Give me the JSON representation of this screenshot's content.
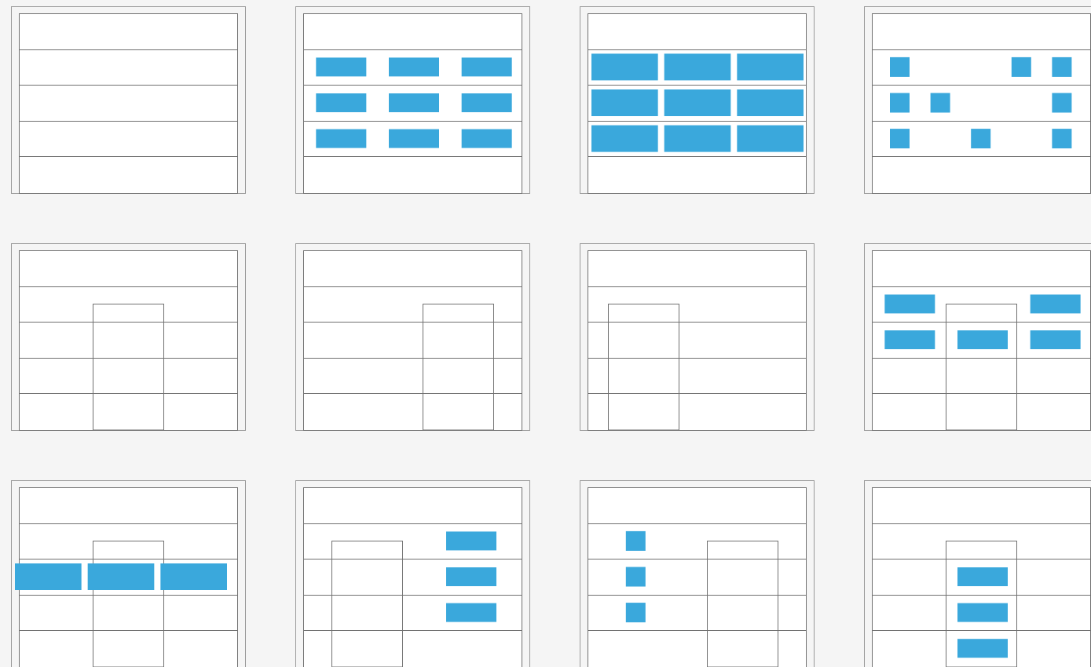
{
  "colors": {
    "background": "#f5f5f5",
    "frame_stroke": "#999999",
    "line_stroke": "#707070",
    "panel_fill": "#ffffff",
    "highlight": "#3aa8dc"
  },
  "diagrams": [
    {
      "id": "plain",
      "window": null,
      "blocks": []
    },
    {
      "id": "grid-padded",
      "window": null,
      "blocks": [
        {
          "row": 1,
          "col": 0,
          "size": "pad"
        },
        {
          "row": 1,
          "col": 1,
          "size": "pad"
        },
        {
          "row": 1,
          "col": 2,
          "size": "pad"
        },
        {
          "row": 2,
          "col": 0,
          "size": "pad"
        },
        {
          "row": 2,
          "col": 1,
          "size": "pad"
        },
        {
          "row": 2,
          "col": 2,
          "size": "pad"
        },
        {
          "row": 3,
          "col": 0,
          "size": "pad"
        },
        {
          "row": 3,
          "col": 1,
          "size": "pad"
        },
        {
          "row": 3,
          "col": 2,
          "size": "pad"
        }
      ]
    },
    {
      "id": "grid-full",
      "window": null,
      "blocks": [
        {
          "row": 1,
          "col": 0,
          "size": "full"
        },
        {
          "row": 1,
          "col": 1,
          "size": "full"
        },
        {
          "row": 1,
          "col": 2,
          "size": "full"
        },
        {
          "row": 2,
          "col": 0,
          "size": "full"
        },
        {
          "row": 2,
          "col": 1,
          "size": "full"
        },
        {
          "row": 2,
          "col": 2,
          "size": "full"
        },
        {
          "row": 3,
          "col": 0,
          "size": "full"
        },
        {
          "row": 3,
          "col": 1,
          "size": "full"
        },
        {
          "row": 3,
          "col": 2,
          "size": "full"
        }
      ]
    },
    {
      "id": "scattered-squares",
      "window": null,
      "blocks": [
        {
          "row": 1,
          "slot": 0,
          "size": "square"
        },
        {
          "row": 1,
          "slot": 6,
          "size": "square"
        },
        {
          "row": 1,
          "slot": 8,
          "size": "square"
        },
        {
          "row": 2,
          "slot": 0,
          "size": "square"
        },
        {
          "row": 2,
          "slot": 2,
          "size": "square"
        },
        {
          "row": 2,
          "slot": 8,
          "size": "square"
        },
        {
          "row": 3,
          "slot": 0,
          "size": "square"
        },
        {
          "row": 3,
          "slot": 4,
          "size": "square"
        },
        {
          "row": 3,
          "slot": 8,
          "size": "square"
        }
      ]
    },
    {
      "id": "window-center",
      "window": "center",
      "blocks": []
    },
    {
      "id": "window-right",
      "window": "right",
      "blocks": []
    },
    {
      "id": "window-left",
      "window": "left",
      "blocks": []
    },
    {
      "id": "window-center-with-blocks",
      "window": "center",
      "blocks": [
        {
          "row": 1,
          "col": 0,
          "size": "pad"
        },
        {
          "row": 1,
          "col": 2,
          "size": "pad"
        },
        {
          "row": 2,
          "col": 0,
          "size": "pad"
        },
        {
          "row": 2,
          "col": 1,
          "size": "pad"
        },
        {
          "row": 2,
          "col": 2,
          "size": "pad"
        }
      ]
    },
    {
      "id": "window-center-band",
      "window": "center",
      "blocks": [
        {
          "row": 2,
          "col": 0,
          "size": "band"
        },
        {
          "row": 2,
          "col": 1,
          "size": "band"
        },
        {
          "row": 2,
          "col": 2,
          "size": "band"
        }
      ]
    },
    {
      "id": "window-left-blocks-right",
      "window": "left2",
      "blocks": [
        {
          "row": 1,
          "col": 2,
          "size": "pad-right"
        },
        {
          "row": 2,
          "col": 2,
          "size": "pad-right"
        },
        {
          "row": 3,
          "col": 2,
          "size": "pad-right"
        }
      ]
    },
    {
      "id": "window-right-squares-left",
      "window": "right2",
      "blocks": [
        {
          "row": 1,
          "slot": 1,
          "size": "square"
        },
        {
          "row": 2,
          "slot": 1,
          "size": "square"
        },
        {
          "row": 3,
          "slot": 1,
          "size": "square"
        }
      ]
    },
    {
      "id": "window-center-stack",
      "window": "center",
      "blocks": [
        {
          "row": 2,
          "col": 1,
          "size": "pad"
        },
        {
          "row": 3,
          "col": 1,
          "size": "pad"
        },
        {
          "row": 4,
          "col": 1,
          "size": "pad"
        }
      ]
    }
  ]
}
